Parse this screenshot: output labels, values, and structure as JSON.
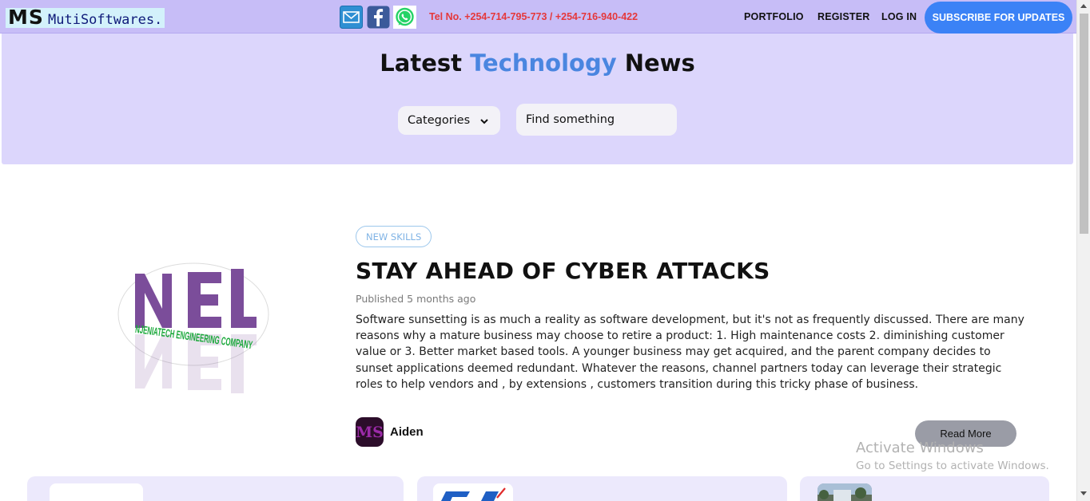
{
  "header": {
    "logo": {
      "initials": "MS",
      "name": "MutiSoftwares."
    },
    "social": [
      {
        "name": "email",
        "icon": "email-icon"
      },
      {
        "name": "facebook",
        "icon": "facebook-icon"
      },
      {
        "name": "whatsapp",
        "icon": "whatsapp-icon"
      }
    ],
    "phone": "Tel No. +254-714-795-773 / +254-716-940-422",
    "nav": {
      "portfolio": "PORTFOLIO",
      "register": "REGISTER",
      "login": "LOG IN",
      "subscribe": "SUBSCRIBE FOR UPDATES"
    }
  },
  "hero": {
    "title_start": "Latest ",
    "title_accent": "Technology",
    "title_end": " News",
    "categories_label": "Categories",
    "search_placeholder": "Find something"
  },
  "article": {
    "image_logo": {
      "letters": "NEL",
      "company": "NJENIATECH ENGINEERING COMPANY"
    },
    "tag": "NEW SKILLS",
    "title": "STAY AHEAD OF CYBER ATTACKS",
    "published": "Published 5 months ago",
    "excerpt": "Software sunsetting is as much a reality as software development, but it's not as frequently discussed. There are many reasons why a mature business may choose to retire a product: 1. High maintenance costs 2. diminishing customer value or 3. Better market based tools. A younger business may get acquired, and the parent company decides to sunset applications deemed redundant. Whatever the reasons, channel partners today can leverage their strategic roles to help vendors and , by extensions , customers transition during this tricky phase of business.",
    "author": {
      "initials": "MS",
      "name": "Aiden"
    },
    "read_more": "Read More"
  },
  "watermark": {
    "title": "Activate Windows",
    "subtitle": "Go to Settings to activate Windows."
  },
  "colors": {
    "header_bg": "#c7bdf7",
    "hero_bg": "#dcd6fc",
    "accent": "#4a86e0",
    "subscribe_bg": "#3b82f6",
    "phone_text": "#e5383b",
    "card_bg": "#ece9fc"
  }
}
